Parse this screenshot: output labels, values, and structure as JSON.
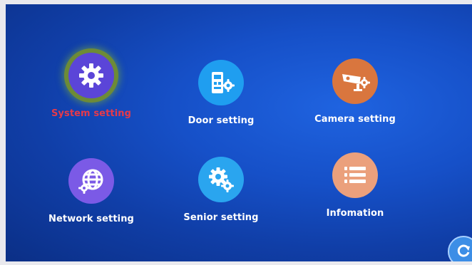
{
  "menu": {
    "items": [
      {
        "label": "System setting",
        "icon": "gear-icon",
        "color": "#5b45d8",
        "active": true
      },
      {
        "label": "Door setting",
        "icon": "door-station-icon",
        "color": "#1f9ef0",
        "active": false
      },
      {
        "label": "Camera setting",
        "icon": "security-camera-icon",
        "color": "#d9763e",
        "active": false
      },
      {
        "label": "Network setting",
        "icon": "globe-icon",
        "color": "#7b5ae6",
        "active": false
      },
      {
        "label": "Senior setting",
        "icon": "gears-icon",
        "color": "#2aa5ef",
        "active": false
      },
      {
        "label": "Infomation",
        "icon": "list-icon",
        "color": "#eba07c",
        "active": false
      }
    ]
  },
  "controls": {
    "refresh_icon": "refresh-icon"
  },
  "colors": {
    "background": "#1650c8",
    "active_label": "#e63a4a",
    "label": "#ffffff"
  }
}
